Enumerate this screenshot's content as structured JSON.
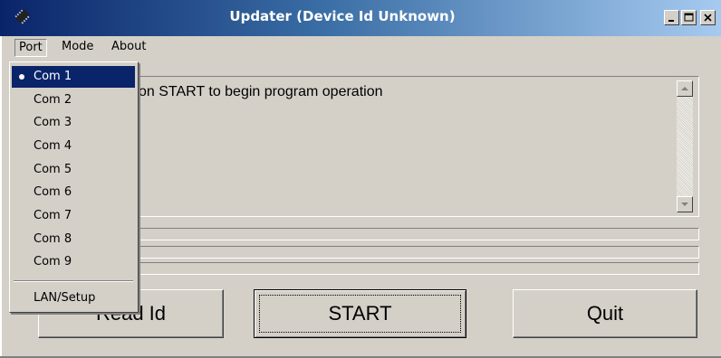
{
  "window": {
    "title": "Updater (Device Id Unknown)",
    "title_gradient_start": "#0a246a",
    "title_gradient_end": "#a6caf0"
  },
  "menubar": {
    "port": "Port",
    "mode": "Mode",
    "about": "About"
  },
  "port_menu": {
    "items": [
      "Com 1",
      "Com 2",
      "Com 3",
      "Com 4",
      "Com 5",
      "Com 6",
      "Com 7",
      "Com 8",
      "Com 9"
    ],
    "selected": "Com 1",
    "lan": "LAN/Setup",
    "highlight_color": "#0a246a"
  },
  "message": {
    "text": "on START to begin program operation"
  },
  "buttons": {
    "read_id": "Read Id",
    "start": "START",
    "quit": "Quit"
  },
  "icons": {
    "app": "chip-icon",
    "minimize": "minimize-icon",
    "maximize": "maximize-icon",
    "close": "close-icon",
    "scroll_up": "arrow-up-icon",
    "scroll_down": "arrow-down-icon"
  }
}
